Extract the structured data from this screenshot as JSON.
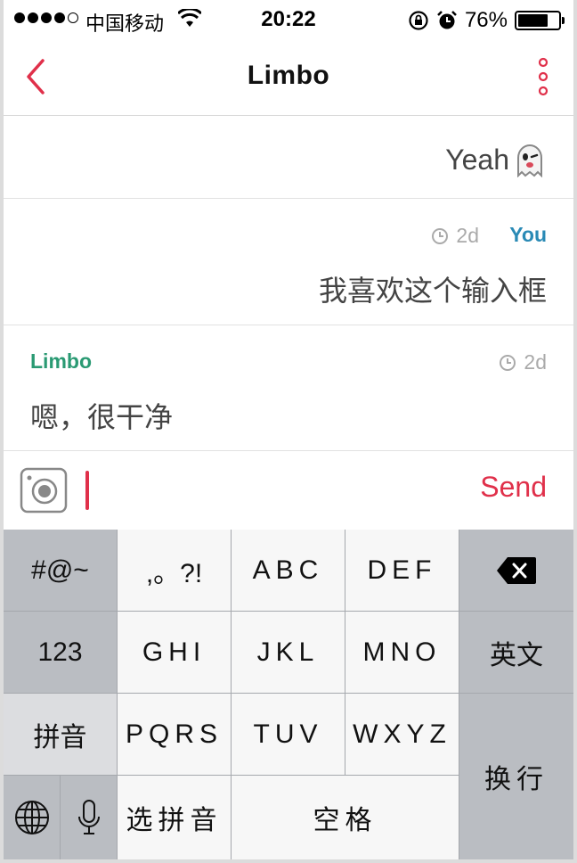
{
  "status_bar": {
    "carrier": "中国移动",
    "time": "20:22",
    "battery_percent": "76%",
    "battery_level": 0.76
  },
  "nav": {
    "title": "Limbo"
  },
  "messages": [
    {
      "text": "Yeah"
    },
    {
      "author": "You",
      "time": "2d",
      "text": "我喜欢这个输入框"
    },
    {
      "author": "Limbo",
      "time": "2d",
      "text": "嗯，很干净"
    }
  ],
  "input": {
    "send_label": "Send"
  },
  "keyboard": {
    "symbols": "#@~",
    "punct": ",。?!",
    "abc": "ABC",
    "def": "DEF",
    "num": "123",
    "ghi": "GHI",
    "jkl": "JKL",
    "mno": "MNO",
    "english": "英文",
    "pinyin": "拼音",
    "pqrs": "PQRS",
    "tuv": "TUV",
    "wxyz": "WXYZ",
    "return": "换行",
    "select_pinyin": "选拼音",
    "space": "空格"
  },
  "colors": {
    "accent": "#e0304a",
    "you": "#2a8ab5",
    "limbo": "#2a9a73"
  }
}
